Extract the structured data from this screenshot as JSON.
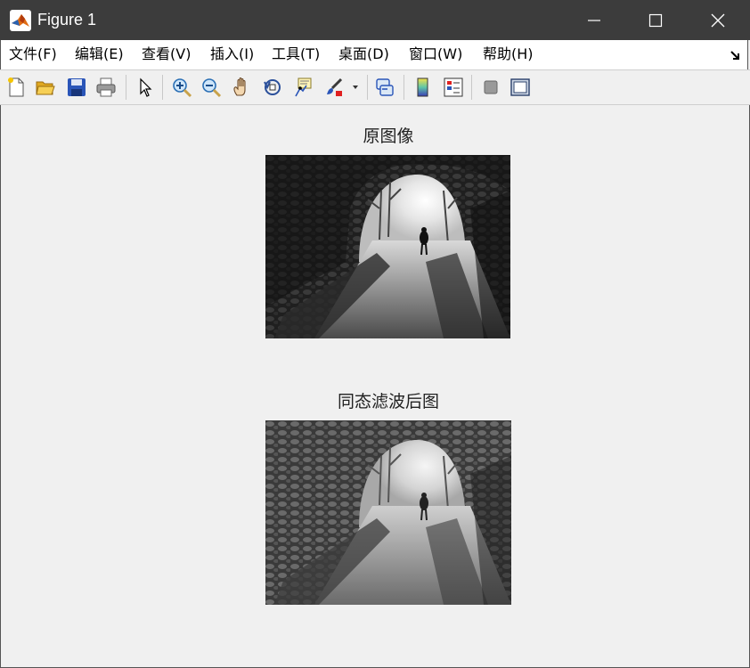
{
  "window": {
    "title": "Figure 1"
  },
  "menubar": {
    "items": [
      {
        "label": "文件(F)"
      },
      {
        "label": "编辑(E)"
      },
      {
        "label": "查看(V)"
      },
      {
        "label": "插入(I)"
      },
      {
        "label": "工具(T)"
      },
      {
        "label": "桌面(D)"
      },
      {
        "label": "窗口(W)"
      },
      {
        "label": "帮助(H)"
      }
    ]
  },
  "toolbar": {
    "icons": [
      "new-figure-icon",
      "open-file-icon",
      "save-icon",
      "print-icon",
      "edit-plot-pointer-icon",
      "zoom-in-icon",
      "zoom-out-icon",
      "pan-hand-icon",
      "rotate-3d-icon",
      "data-cursor-icon",
      "brush-icon",
      "brush-dropdown-icon",
      "link-plot-icon",
      "insert-colorbar-icon",
      "insert-legend-icon",
      "hide-plot-tools-icon",
      "show-plot-tools-icon"
    ]
  },
  "figure": {
    "subplots": [
      {
        "title": "原图像"
      },
      {
        "title": "同态滤波后图"
      }
    ]
  }
}
